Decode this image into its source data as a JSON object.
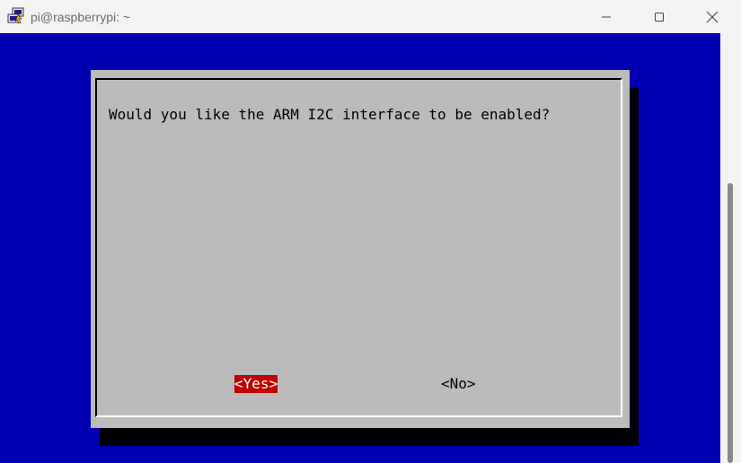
{
  "window": {
    "title": "pi@raspberrypi: ~",
    "icon": "putty-icon",
    "controls": {
      "minimize": "minimize-icon",
      "maximize": "maximize-icon",
      "close": "close-icon"
    }
  },
  "terminal": {
    "background_color": "#0000b2"
  },
  "dialog": {
    "prompt": "Would you like the ARM I2C interface to be enabled?",
    "buttons": {
      "yes": "<Yes>",
      "no": "<No>"
    },
    "selected_button": "yes",
    "colors": {
      "dialog_bg": "#bbbbbb",
      "selected_bg": "#c00000",
      "selected_fg": "#ffffff"
    }
  }
}
